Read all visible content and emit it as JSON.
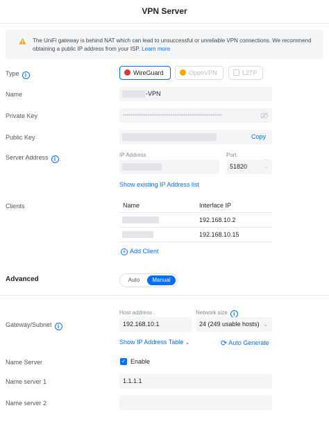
{
  "header": {
    "title": "VPN Server"
  },
  "warning": {
    "message": "The UniFi gateway is behind NAT which can lead to unsuccessful or unreliable VPN connections. We recommend obtaining a public IP address from your ISP.",
    "link": "Learn more"
  },
  "type": {
    "label": "Type",
    "options": [
      {
        "label": "WireGuard",
        "selected": true,
        "icon": "wireguard-icon",
        "color": "#d63a3a"
      },
      {
        "label": "OpenVPN",
        "selected": false,
        "icon": "openvpn-icon",
        "color": "#f2a900"
      },
      {
        "label": "L2TP",
        "selected": false,
        "icon": "l2tp-icon"
      }
    ]
  },
  "name": {
    "label": "Name",
    "value": "-VPN"
  },
  "private_key": {
    "label": "Private Key",
    "value": "••••••••••••••••••••••••••••••••••••••••••••••••••••"
  },
  "public_key": {
    "label": "Public Key",
    "copy_label": "Copy"
  },
  "server_address": {
    "label": "Server Address",
    "ip_label": "IP Address",
    "port_label": "Port",
    "port_value": "51820",
    "show_link": "Show existing IP Address list"
  },
  "clients": {
    "label": "Clients",
    "columns": [
      "Name",
      "Interface IP"
    ],
    "rows": [
      {
        "interface_ip": "192.168.10.2"
      },
      {
        "interface_ip": "192.168.10.15"
      }
    ],
    "add_label": "Add Client"
  },
  "advanced": {
    "title": "Advanced",
    "options": [
      "Auto",
      "Manual"
    ],
    "selected": "Manual"
  },
  "gateway": {
    "label": "Gateway/Subnet",
    "host_label": "Host address",
    "host_value": "192.168.10.1",
    "network_label": "Network size",
    "network_value": "24 (249 usable hosts)",
    "show_table": "Show IP Address Table",
    "auto_generate": "Auto Generate"
  },
  "name_server": {
    "label": "Name Server",
    "enable_label": "Enable",
    "enabled": true
  },
  "name_server_1": {
    "label": "Name server 1",
    "value": "1.1.1.1"
  },
  "name_server_2": {
    "label": "Name server 2",
    "value": ""
  },
  "colors": {
    "accent": "#006fff",
    "warning": "#f5a623",
    "field_bg": "#f4f5f6"
  }
}
